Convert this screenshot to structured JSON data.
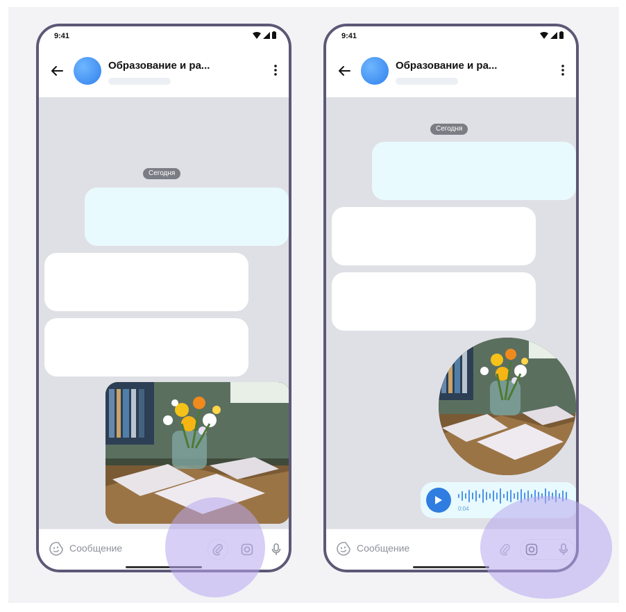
{
  "screens": [
    {
      "status": {
        "time": "9:41"
      },
      "header": {
        "title": "Образование и ра..."
      },
      "chat": {
        "date_label": "Сегодня"
      },
      "input": {
        "placeholder": "Сообщение"
      }
    },
    {
      "status": {
        "time": "9:41"
      },
      "header": {
        "title": "Образование и ра..."
      },
      "chat": {
        "date_label": "Сегодня",
        "voice_duration": "0:04"
      },
      "input": {
        "placeholder": "Сообщение"
      }
    }
  ],
  "icons": {
    "back": "arrow-left-icon",
    "menu": "kebab-menu-icon",
    "emoji": "sticker-icon",
    "attach": "paperclip-icon",
    "camera": "camera-icon",
    "mic": "microphone-icon",
    "play": "play-icon"
  },
  "colors": {
    "frame": "#5d5876",
    "outgoing_bubble": "#e8fafd",
    "incoming_bubble": "#ffffff",
    "chat_background": "#dfe0e5",
    "accent": "#2f7de1",
    "highlight": "#b7a8ee"
  }
}
